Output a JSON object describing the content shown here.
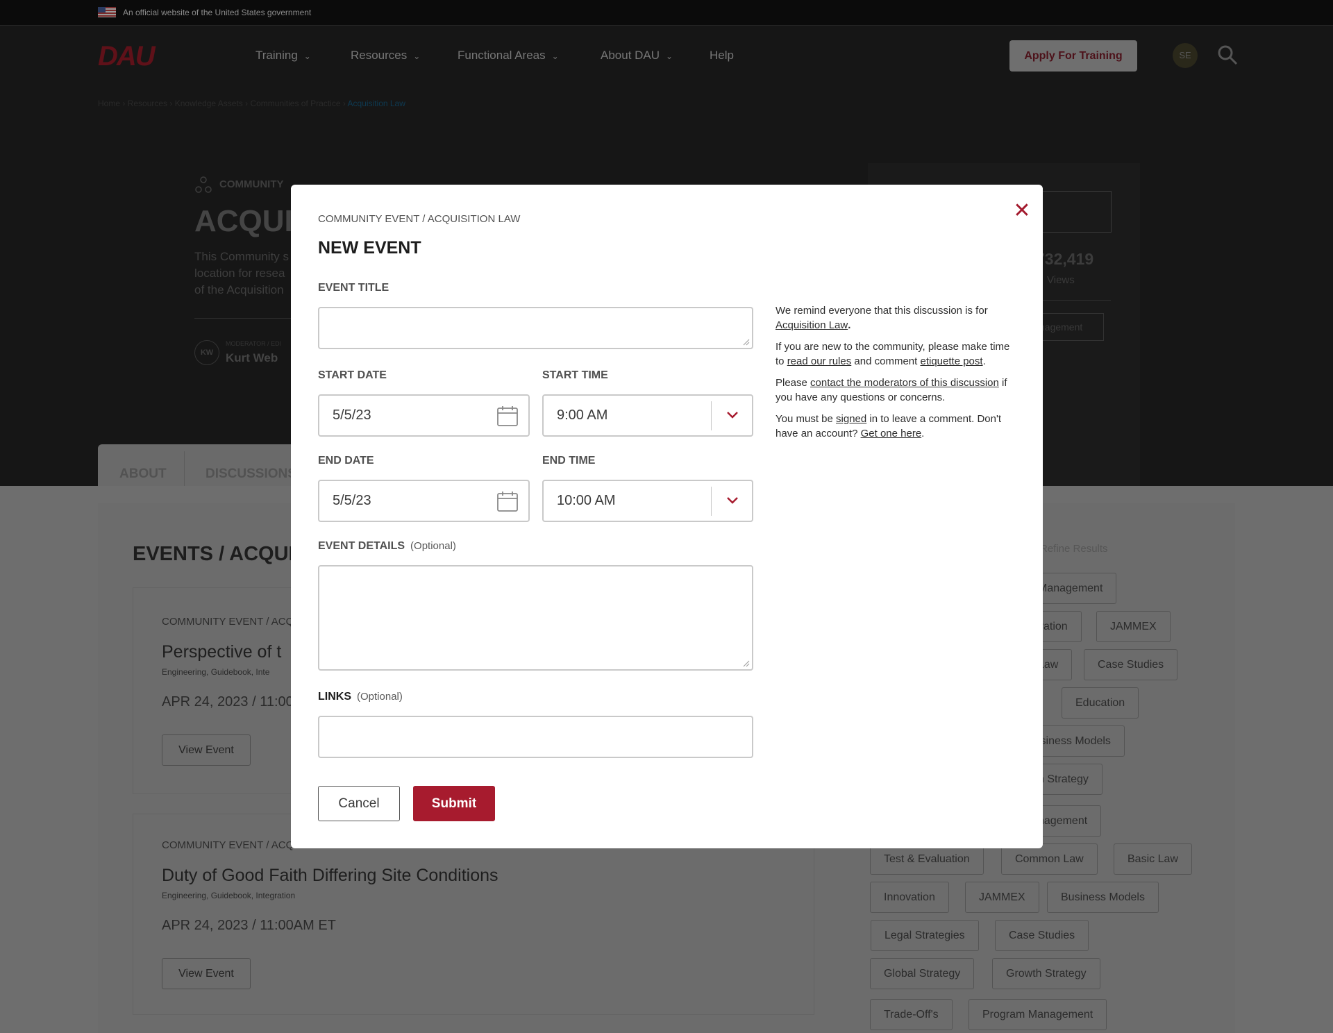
{
  "gov_banner": {
    "text": "An official website of the United States government"
  },
  "header": {
    "logo": "DAU",
    "nav": [
      "Training",
      "Resources",
      "Functional Areas",
      "About DAU",
      "Help"
    ],
    "apply_label": "Apply For Training",
    "avatar": "SE"
  },
  "breadcrumb": [
    "Home",
    "Resources",
    "Knowledge Assets",
    "Communities of Practice",
    "Acquisition Law"
  ],
  "hero": {
    "type_label": "COMMUNITY",
    "title": "ACQUIS",
    "desc_lines": [
      "This Community s",
      "location for resea",
      "of the Acquisition"
    ],
    "moderator_initials": "KW",
    "moderator_label": "MODERATOR / EDI",
    "moderator_name": "Kurt Web",
    "views_count": "732,419",
    "views_label": "Views",
    "side_tag": "nagement"
  },
  "tabs": [
    "ABOUT",
    "DISCUSSIONS"
  ],
  "events_heading": "EVENTS / ACQUIS",
  "refine_label": "Refine Results",
  "event_cards": [
    {
      "category": "COMMUNITY EVENT / ACQ",
      "title": "Perspective of t",
      "tags": "Engineering,  Guidebook,  Inte",
      "date": "APR 24, 2023 / 11:00",
      "button": "View Event"
    },
    {
      "category": "COMMUNITY EVENT / ACQUISITION LAW",
      "title": "Duty of Good Faith Differing Site Conditions",
      "tags": "Engineering,  Guidebook,  Integration",
      "date": "APR 24, 2023 / 11:00AM ET",
      "button": "View Event"
    }
  ],
  "filter_tags": [
    "Management",
    "vation",
    "JAMMEX",
    "Law",
    "Case Studies",
    "Education",
    "isiness Models",
    "n Strategy",
    "nagement",
    "Test & Evaluation",
    "Common Law",
    "Basic Law",
    "Innovation",
    "JAMMEX",
    "Business Models",
    "Legal Strategies",
    "Case Studies",
    "Global Strategy",
    "Growth Strategy",
    "Trade-Off's",
    "Program Management"
  ],
  "modal": {
    "breadcrumb": "COMMUNITY EVENT / ACQUISITION LAW",
    "title": "NEW EVENT",
    "event_title_label": "EVENT TITLE",
    "event_title_value": "",
    "start_date_label": "START DATE",
    "start_date_value": "5/5/23",
    "start_time_label": "START TIME",
    "start_time_value": "9:00 AM",
    "end_date_label": "END DATE",
    "end_date_value": "5/5/23",
    "end_time_label": "END TIME",
    "end_time_value": "10:00 AM",
    "details_label": "EVENT DETAILS",
    "optional": "(Optional)",
    "links_label": "LINKS",
    "cancel": "Cancel",
    "submit": "Submit",
    "info": {
      "p1_text": "We remind everyone that this discussion is for",
      "p1_link": "Acquisition Law",
      "p2_text_a": "If you are new to the community, please make time to",
      "p2_link_a": "read our rules",
      "p2_text_b": "and comment",
      "p2_link_b": "etiquette post",
      "p3_text_a": "Please",
      "p3_link": "contact the moderators of this discussion",
      "p3_text_b": "if you have any questions or concerns.",
      "p4_text_a": "You must be",
      "p4_link_a": "signed",
      "p4_text_b": "in to leave a comment. Don't have an account?",
      "p4_link_b": "Get one here"
    }
  },
  "colors": {
    "accent": "#a71b2e",
    "overlay": "#6e6e6e"
  }
}
